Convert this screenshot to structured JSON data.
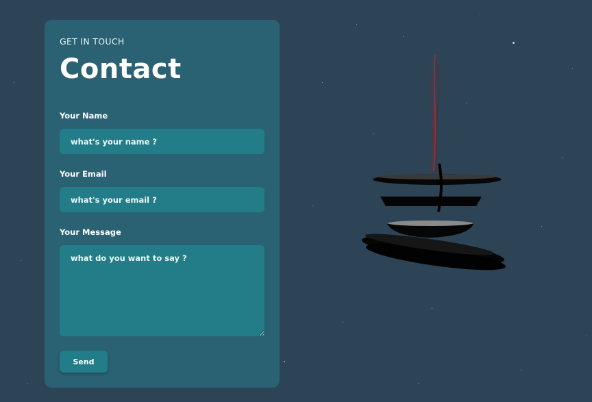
{
  "form": {
    "eyebrow": "GET IN TOUCH",
    "title": "Contact",
    "name_label": "Your Name",
    "name_placeholder": "what's your name ?",
    "email_label": "Your Email",
    "email_placeholder": "what's your email ?",
    "message_label": "Your Message",
    "message_placeholder": "what do you want to say ?",
    "send_label": "Send"
  },
  "colors": {
    "page_background": "#2d4456",
    "card_background": "#2a6173",
    "input_background": "#237d88",
    "model_accent": "#c0262b"
  }
}
